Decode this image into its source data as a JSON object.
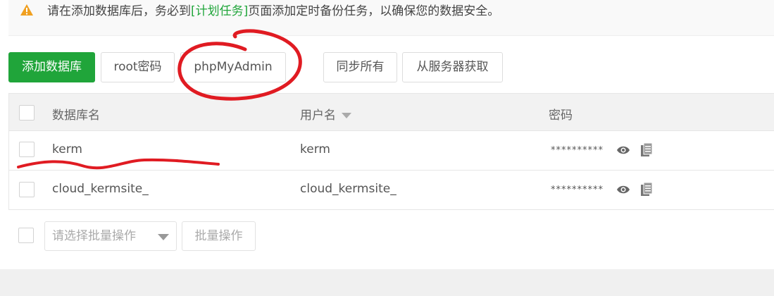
{
  "notice": {
    "prefix": "请在添加数据库后，务必到",
    "link": "[计划任务]",
    "suffix": "页面添加定时备份任务，以确保您的数据安全。"
  },
  "toolbar": {
    "add_db": "添加数据库",
    "root_pwd": "root密码",
    "phpmyadmin": "phpMyAdmin",
    "sync_all": "同步所有",
    "fetch_server": "从服务器获取"
  },
  "table": {
    "headers": {
      "db_name": "数据库名",
      "username": "用户名",
      "password": "密码"
    },
    "rows": [
      {
        "db_name": "kerm",
        "username": "kerm",
        "password": "**********"
      },
      {
        "db_name": "cloud_kermsite_",
        "username": "cloud_kermsite_",
        "password": "**********"
      }
    ]
  },
  "bulk": {
    "select_placeholder": "请选择批量操作",
    "button": "批量操作"
  },
  "colors": {
    "accent": "#20a53a",
    "warning": "#f0a020",
    "annotation": "#e01b22"
  }
}
